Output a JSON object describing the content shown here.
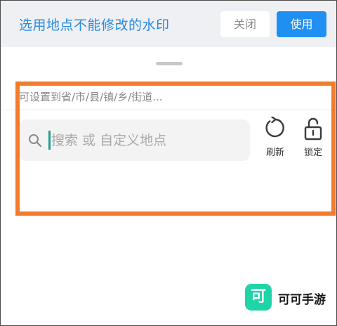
{
  "header": {
    "title": "选用地点不能修改的水印",
    "close_label": "关闭",
    "use_label": "使用"
  },
  "location_panel": {
    "hint": "可设置到省/市/县/镇/乡/街道...",
    "search": {
      "value": "",
      "placeholder": "搜索 或 自定义地点",
      "icon": "search-icon"
    },
    "tools": [
      {
        "icon": "refresh-icon",
        "label": "刷新"
      },
      {
        "icon": "unlock-icon",
        "label": "锁定"
      }
    ]
  },
  "watermark": {
    "logo_char": "可",
    "text": "可可手游"
  },
  "colors": {
    "accent": "#1f8ff2",
    "title": "#2a8be0",
    "highlight": "#f47a2c",
    "cursor": "#1e9e8e",
    "watermark_logo": "#1fd4a8"
  }
}
